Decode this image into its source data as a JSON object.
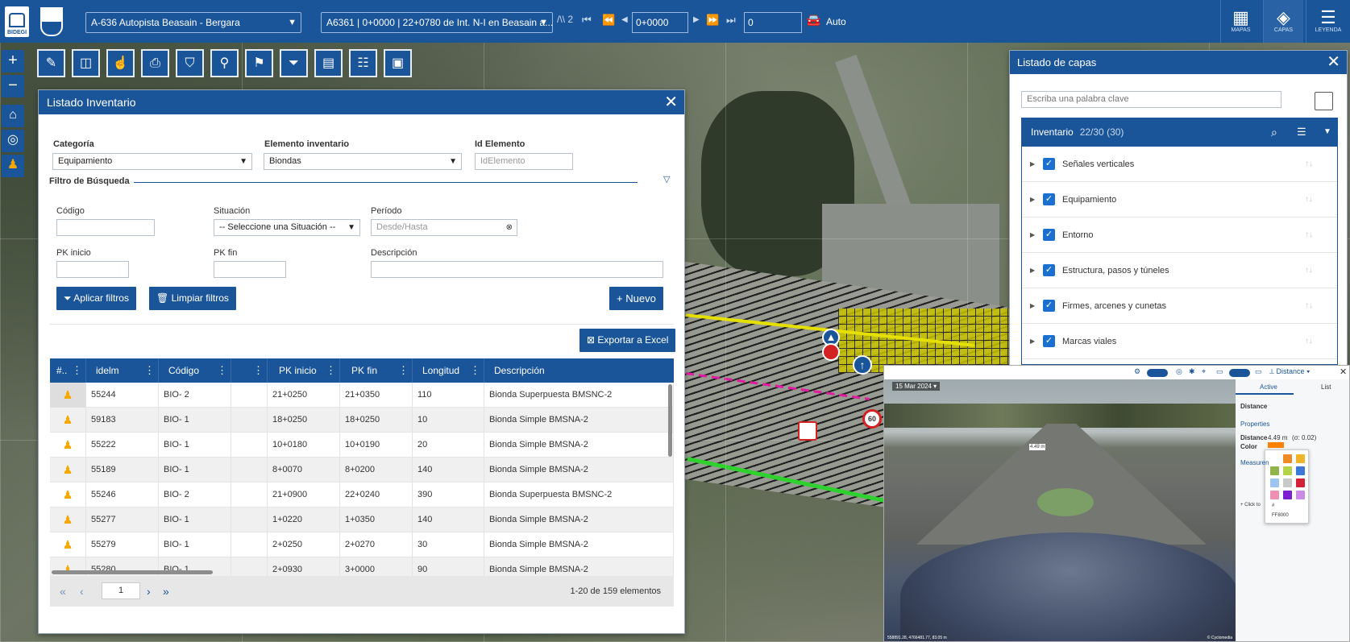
{
  "header": {
    "logo_text": "BIDEGI",
    "road_select": "A-636 Autopista Beasain - Bergara",
    "segment_select": "A6361 | 0+0000 | 22+0780 de Int. N-I en Beasain a...",
    "lanes_label": "/\\\\ 2",
    "pk_value": "0+0000",
    "frame_value": "0",
    "auto_label": "Auto",
    "right": [
      {
        "label": "MAPAS"
      },
      {
        "label": "CAPAS"
      },
      {
        "label": "LEYENDA"
      }
    ]
  },
  "inventory": {
    "title": "Listado Inventario",
    "categoria_label": "Categoría",
    "categoria_value": "Equipamiento",
    "elemento_label": "Elemento inventario",
    "elemento_value": "Biondas",
    "id_label": "Id Elemento",
    "id_placeholder": "IdElemento",
    "filter_section": "Filtro de Búsqueda",
    "codigo_label": "Código",
    "situacion_label": "Situación",
    "situacion_value": "-- Seleccione una Situación --",
    "periodo_label": "Período",
    "periodo_placeholder": "Desde/Hasta",
    "pkinicio_label": "PK inicio",
    "pkfin_label": "PK fin",
    "descripcion_label": "Descripción",
    "apply_btn": "Aplicar filtros",
    "clear_btn": "Limpiar filtros",
    "new_btn": "Nuevo",
    "export_btn": "Exportar a Excel",
    "columns": [
      "#..",
      "idelm",
      "Código",
      "",
      "PK inicio",
      "PK fin",
      "Longitud",
      "Descripción"
    ],
    "rows": [
      {
        "id": "55244",
        "codigo": "BIO- 2",
        "pki": "21+0250",
        "pkf": "21+0350",
        "lon": "110",
        "desc": "Bionda Superpuesta BMSNC-2"
      },
      {
        "id": "59183",
        "codigo": "BIO- 1",
        "pki": "18+0250",
        "pkf": "18+0250",
        "lon": "10",
        "desc": "Bionda Simple BMSNA-2"
      },
      {
        "id": "55222",
        "codigo": "BIO- 1",
        "pki": "10+0180",
        "pkf": "10+0190",
        "lon": "20",
        "desc": "Bionda Simple BMSNA-2"
      },
      {
        "id": "55189",
        "codigo": "BIO- 1",
        "pki": "8+0070",
        "pkf": "8+0200",
        "lon": "140",
        "desc": "Bionda Simple BMSNA-2"
      },
      {
        "id": "55246",
        "codigo": "BIO- 2",
        "pki": "21+0900",
        "pkf": "22+0240",
        "lon": "390",
        "desc": "Bionda Superpuesta BMSNC-2"
      },
      {
        "id": "55277",
        "codigo": "BIO- 1",
        "pki": "1+0220",
        "pkf": "1+0350",
        "lon": "140",
        "desc": "Bionda Simple BMSNA-2"
      },
      {
        "id": "55279",
        "codigo": "BIO- 1",
        "pki": "2+0250",
        "pkf": "2+0270",
        "lon": "30",
        "desc": "Bionda Simple BMSNA-2"
      },
      {
        "id": "55280",
        "codigo": "BIO- 1",
        "pki": "2+0930",
        "pkf": "3+0000",
        "lon": "90",
        "desc": "Bionda Simple BMSNA-2"
      }
    ],
    "page": "1",
    "range_text": "1-20 de 159 elementos"
  },
  "layers": {
    "title": "Listado de capas",
    "search_placeholder": "Escriba una palabra clave",
    "group": "Inventario",
    "group_count": "22/30 (30)",
    "items": [
      "Señales verticales",
      "Equipamiento",
      "Entorno",
      "Estructura, pasos y túneles",
      "Firmes, arcenes y cunetas",
      "Marcas viales"
    ]
  },
  "streetview": {
    "date": "15 Mar 2024",
    "tabs": [
      "Active",
      "List"
    ],
    "tool": "Distance",
    "section_distance": "Distance",
    "section_properties": "Properties",
    "distance_label": "Distance",
    "distance_value": "4.49 m",
    "distance_err": "(σ: 0.02)",
    "color_label": "Color",
    "color_hex": "FF8000",
    "measure_label": "Measuren",
    "click_hint": "+ Click to",
    "coords": "558891.28, 4766481.77, 83.05 m",
    "brand": "© Cyclomedia",
    "sign_60": "60"
  },
  "colors": {
    "primary": "#1a5599",
    "accent": "#f5a800"
  }
}
